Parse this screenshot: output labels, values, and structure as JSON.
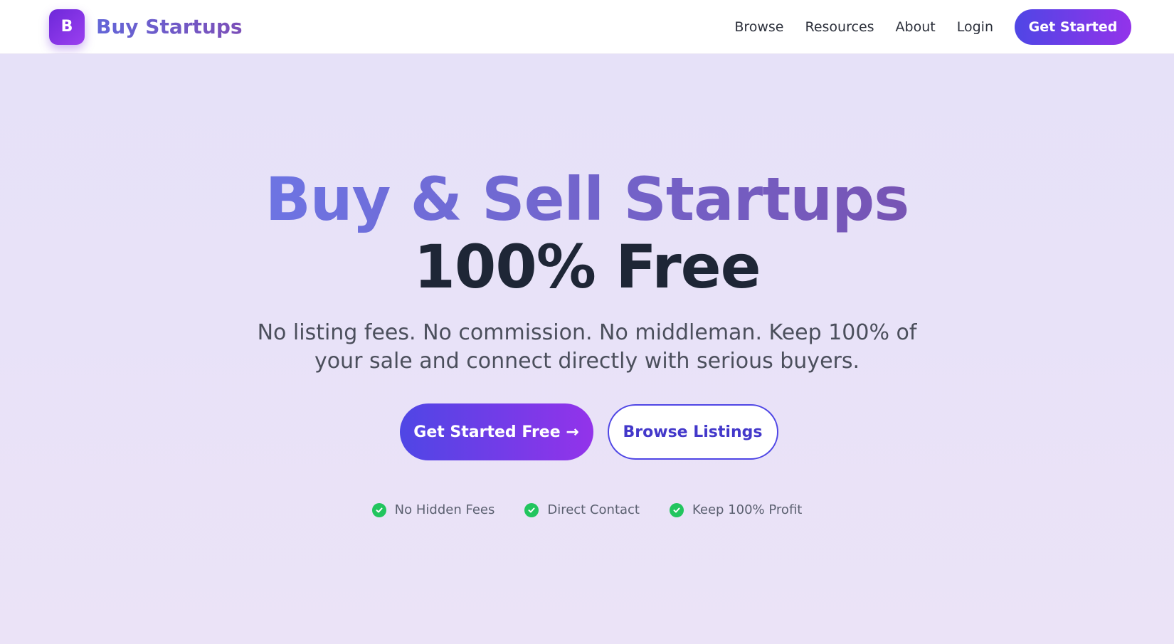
{
  "header": {
    "logo_letter": "B",
    "brand_name": "Buy Startups",
    "nav": [
      {
        "label": "Browse"
      },
      {
        "label": "Resources"
      },
      {
        "label": "About"
      },
      {
        "label": "Login"
      }
    ],
    "cta_label": "Get Started"
  },
  "hero": {
    "headline_line1": "Buy & Sell Startups",
    "headline_line2": "100% Free",
    "subtitle": "No listing fees. No commission. No middleman. Keep 100% of your sale and connect directly with serious buyers.",
    "primary_cta": "Get Started Free →",
    "secondary_cta": "Browse Listings",
    "features": [
      {
        "label": "No Hidden Fees",
        "icon": "check-circle-icon"
      },
      {
        "label": "Direct Contact",
        "icon": "check-circle-icon"
      },
      {
        "label": "Keep 100% Profit",
        "icon": "check-circle-icon"
      }
    ]
  },
  "colors": {
    "accent_start": "#4f46e5",
    "accent_end": "#9333ea",
    "check_green": "#22c55e",
    "headline_dark": "#1e2636"
  }
}
